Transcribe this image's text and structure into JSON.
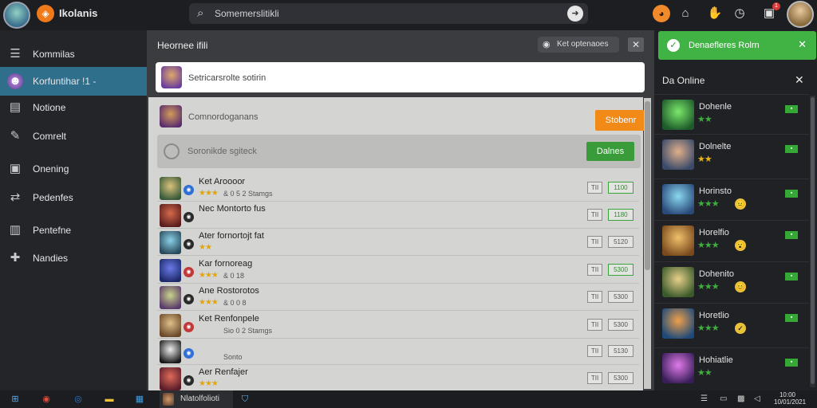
{
  "topbar": {
    "brand_icon": "fox-icon",
    "brand_name": "Ikolanis",
    "search_text": "Somemerslitikli",
    "icons": [
      "fox-face-icon",
      "home-icon",
      "hand-icon",
      "clock-icon",
      "gift-icon"
    ],
    "notification_count": "1"
  },
  "sidebar": {
    "items": [
      {
        "label": "Kommilas",
        "icon": "list-icon"
      },
      {
        "label": "Korfuntihar !1 -",
        "icon": "character-icon"
      },
      {
        "label": "Notione",
        "icon": "message-icon"
      },
      {
        "label": "Comrelt",
        "icon": "edit-icon"
      },
      {
        "label": "Onening",
        "icon": "bag-icon"
      },
      {
        "label": "Pedenfes",
        "icon": "share-icon"
      },
      {
        "label": "Pentefne",
        "icon": "bookmark-icon"
      },
      {
        "label": "Nandies",
        "icon": "puzzle-icon"
      }
    ]
  },
  "main": {
    "title": "Heornee ifili",
    "chip_label": "Ket optenaoes",
    "post_placeholder": "Setricarsrolte sotirin",
    "row_a_label": "Comnordoganans",
    "row_a_button": "Stobenr",
    "row_b_label": "Soronikde sgiteck",
    "row_b_button": "Dalnes",
    "list": [
      {
        "name": "Ket Aroooor",
        "meta": "& 0 5 2 Stamgs",
        "tag": "TII",
        "value": "1100",
        "value_green": true,
        "avatar": [
          "#d8c27a",
          "#3a5a3a"
        ],
        "dot": "blue",
        "stars": "★★★"
      },
      {
        "name": "Nec Montorto fus",
        "meta": "",
        "tag": "TII",
        "value": "1180",
        "value_green": true,
        "avatar": [
          "#d46a4a",
          "#5a1e1e"
        ],
        "dot": "dark",
        "stars": ""
      },
      {
        "name": "Ater fornortojt fat",
        "meta": "",
        "tag": "TII",
        "value": "5120",
        "value_green": false,
        "avatar": [
          "#8ad0e8",
          "#2a4a5a"
        ],
        "dot": "dark",
        "stars": "★★"
      },
      {
        "name": "Kar fornoreag",
        "meta": "& 0 18",
        "tag": "TII",
        "value": "5300",
        "value_green": true,
        "avatar": [
          "#6a7ae8",
          "#1e2a6a"
        ],
        "dot": "red",
        "stars": "★★★"
      },
      {
        "name": "Ane Rostorotos",
        "meta": "& 0 0 8",
        "tag": "TII",
        "value": "5300",
        "value_green": false,
        "avatar": [
          "#c8d48a",
          "#5a3a6a"
        ],
        "dot": "dark",
        "stars": "★★★"
      },
      {
        "name": "Ket Renfonpele",
        "meta": "Sio 0 2 Stamgs",
        "tag": "TII",
        "value": "5300",
        "value_green": false,
        "avatar": [
          "#e0c08a",
          "#6a4a2a"
        ],
        "dot": "red",
        "stars": ""
      },
      {
        "name": "",
        "meta": "Sonto",
        "tag": "TII",
        "value": "5130",
        "value_green": false,
        "avatar": [
          "#ededed",
          "#1a1a1a"
        ],
        "dot": "blue",
        "stars": ""
      },
      {
        "name": "Aer Renfajer",
        "meta": "",
        "tag": "TII",
        "value": "5300",
        "value_green": false,
        "avatar": [
          "#e06a5a",
          "#5a1e2a"
        ],
        "dot": "dark",
        "stars": "★★★"
      }
    ]
  },
  "right": {
    "toast": "Denaefleres Rolrn",
    "online_title": "Da Online",
    "online": [
      {
        "name": "Dohenle",
        "stars": "★★",
        "gold": "",
        "emoji": "",
        "avatar": [
          "#7ae86a",
          "#1e5a2a"
        ]
      },
      {
        "name": "Dolnelte",
        "stars": "",
        "gold": "★★",
        "emoji": "",
        "avatar": [
          "#e0b08a",
          "#3a4a6a"
        ]
      },
      {
        "name": "Horinsto",
        "stars": "★★★",
        "gold": "",
        "emoji": "😐",
        "avatar": [
          "#8ad8f0",
          "#2a4a7a"
        ]
      },
      {
        "name": "Horelfio",
        "stars": "★★★",
        "gold": "",
        "emoji": "😮",
        "avatar": [
          "#f0c06a",
          "#7a4a1e"
        ]
      },
      {
        "name": "Dohenito",
        "stars": "★★★",
        "gold": "",
        "emoji": "😊",
        "avatar": [
          "#e8d08a",
          "#3a5a2a"
        ]
      },
      {
        "name": "Horetlio",
        "stars": "★★★",
        "gold": "",
        "emoji": "✓",
        "avatar": [
          "#f0a04a",
          "#1e4a7a"
        ]
      },
      {
        "name": "Hohiatlie",
        "stars": "★★",
        "gold": "",
        "emoji": "",
        "avatar": [
          "#e07ae8",
          "#3a1e5a"
        ]
      }
    ]
  },
  "taskbar": {
    "app_label": "Nlatolfolioti",
    "clock_time": "10:00",
    "clock_date": "10/01/2021"
  }
}
